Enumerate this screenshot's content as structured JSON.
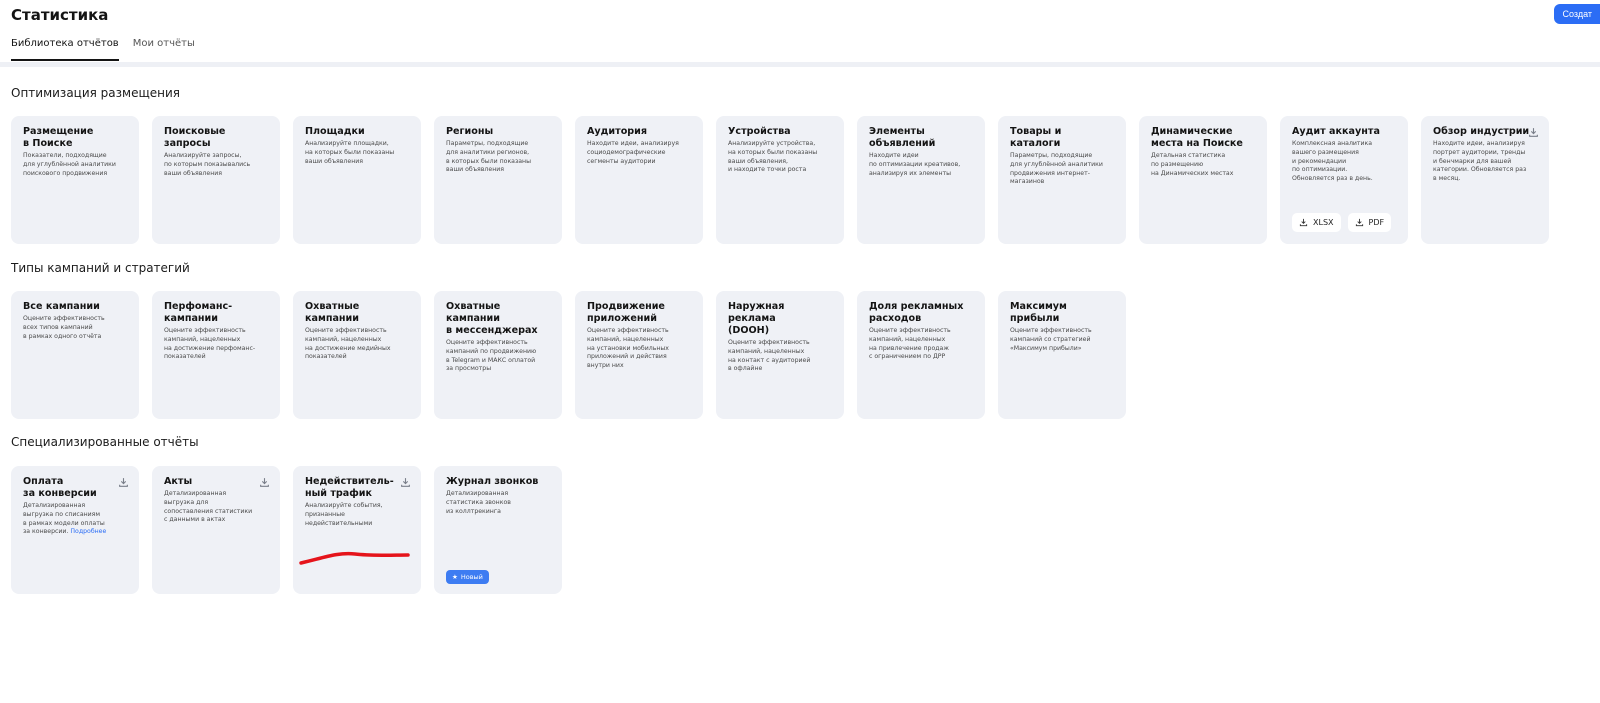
{
  "header": {
    "title": "Статистика",
    "create_label": "Создат"
  },
  "tabs": [
    {
      "label": "Библиотека отчётов",
      "active": true
    },
    {
      "label": "Мои отчёты",
      "active": false
    }
  ],
  "sections": {
    "optimization": {
      "title": "Оптимизация размещения",
      "cards": [
        {
          "title": "Размещение\nв Поиске",
          "desc": "Показатели, подходящие\nдля углублённой аналитики\nпоискового продвижения"
        },
        {
          "title": "Поисковые запросы",
          "desc": "Анализируйте запросы,\nпо которым показывались\nваши объявления"
        },
        {
          "title": "Площадки",
          "desc": "Анализируйте площадки,\nна которых были показаны\nваши объявления"
        },
        {
          "title": "Регионы",
          "desc": "Параметры, подходящие\nдля аналитики регионов,\nв которых были показаны\nваши объявления"
        },
        {
          "title": "Аудитория",
          "desc": "Находите идеи, анализируя\nсоциодемографические\nсегменты аудитории"
        },
        {
          "title": "Устройства",
          "desc": "Анализируйте устройства,\nна которых были показаны\nваши объявления,\nи находите точки роста"
        },
        {
          "title": "Элементы\nобъявлений",
          "desc": "Находите идеи\nпо оптимизации креативов,\nанализируя их элементы"
        },
        {
          "title": "Товары и каталоги",
          "desc": "Параметры, подходящие\nдля углублённой аналитики\nпродвижения интернет-\nмагазинов"
        },
        {
          "title": "Динамические\nместа на Поиске",
          "desc": "Детальная статистика\nпо размещению\nна Динамических местах"
        },
        {
          "title": "Аудит аккаунта",
          "desc": "Комплексная аналитика\nвашего размещения\nи рекомендации\nпо оптимизации.\nОбновляется раз в день.",
          "xlsx": "XLSX",
          "pdf": "PDF"
        },
        {
          "title": "Обзор индустрии",
          "desc": "Находите идеи, анализируя\nпортрет аудитории, тренды\nи бенчмарки для вашей\nкатегории. Обновляется раз\nв месяц."
        }
      ]
    },
    "campaigns": {
      "title": "Типы кампаний и стратегий",
      "cards": [
        {
          "title": "Все кампании",
          "desc": "Оцените эффективность\nвсех типов кампаний\nв рамках одного отчёта"
        },
        {
          "title": "Перфоманс-\nкампании",
          "desc": "Оцените эффективность\nкампаний, нацеленных\nна достижение перфоманс-\nпоказателей"
        },
        {
          "title": "Охватные кампании",
          "desc": "Оцените эффективность\nкампаний, нацеленных\nна достижение медийных\nпоказателей"
        },
        {
          "title": "Охватные кампании\nв мессенджерах",
          "desc": "Оцените эффективность\nкампаний по продвижению\nв Telegram и МАКС оплатой\nза просмотры"
        },
        {
          "title": "Продвижение\nприложений",
          "desc": "Оцените эффективность\nкампаний, нацеленных\nна установки мобильных\nприложений и действия\nвнутри них"
        },
        {
          "title": "Наружная реклама\n(DOOH)",
          "desc": "Оцените эффективность\nкампаний, нацеленных\nна контакт с аудиторией\nв офлайне"
        },
        {
          "title": "Доля рекламных\nрасходов",
          "desc": "Оцените эффективность\nкампаний, нацеленных\nна привлечение продаж\nс ограничением по ДРР"
        },
        {
          "title": "Максимум прибыли",
          "desc": "Оцените эффективность\nкампаний со стратегией\n«Максимум прибыли»"
        }
      ]
    },
    "special": {
      "title": "Специализированные отчёты",
      "cards": [
        {
          "title": "Оплата\nза конверсии",
          "desc": "Детализированная\nвыгрузка по списаниям\nв рамках модели оплаты\nза конверсии.",
          "link": "Подробнее"
        },
        {
          "title": "Акты",
          "desc": "Детализированная\nвыгрузка для\nсопоставления статистики\nс данными в актах"
        },
        {
          "title": "Недействитель-\nный трафик",
          "desc": "Анализируйте события,\nпризнанные\nнедействительными"
        },
        {
          "title": "Журнал звонков",
          "desc": "Детализированная\nстатистика звонков\nиз коллтрекинга",
          "badge": "Новый"
        }
      ]
    }
  },
  "colors": {
    "accent": "#2b6df5",
    "card_bg": "#eff1f6",
    "annotation": "#e5141b"
  }
}
